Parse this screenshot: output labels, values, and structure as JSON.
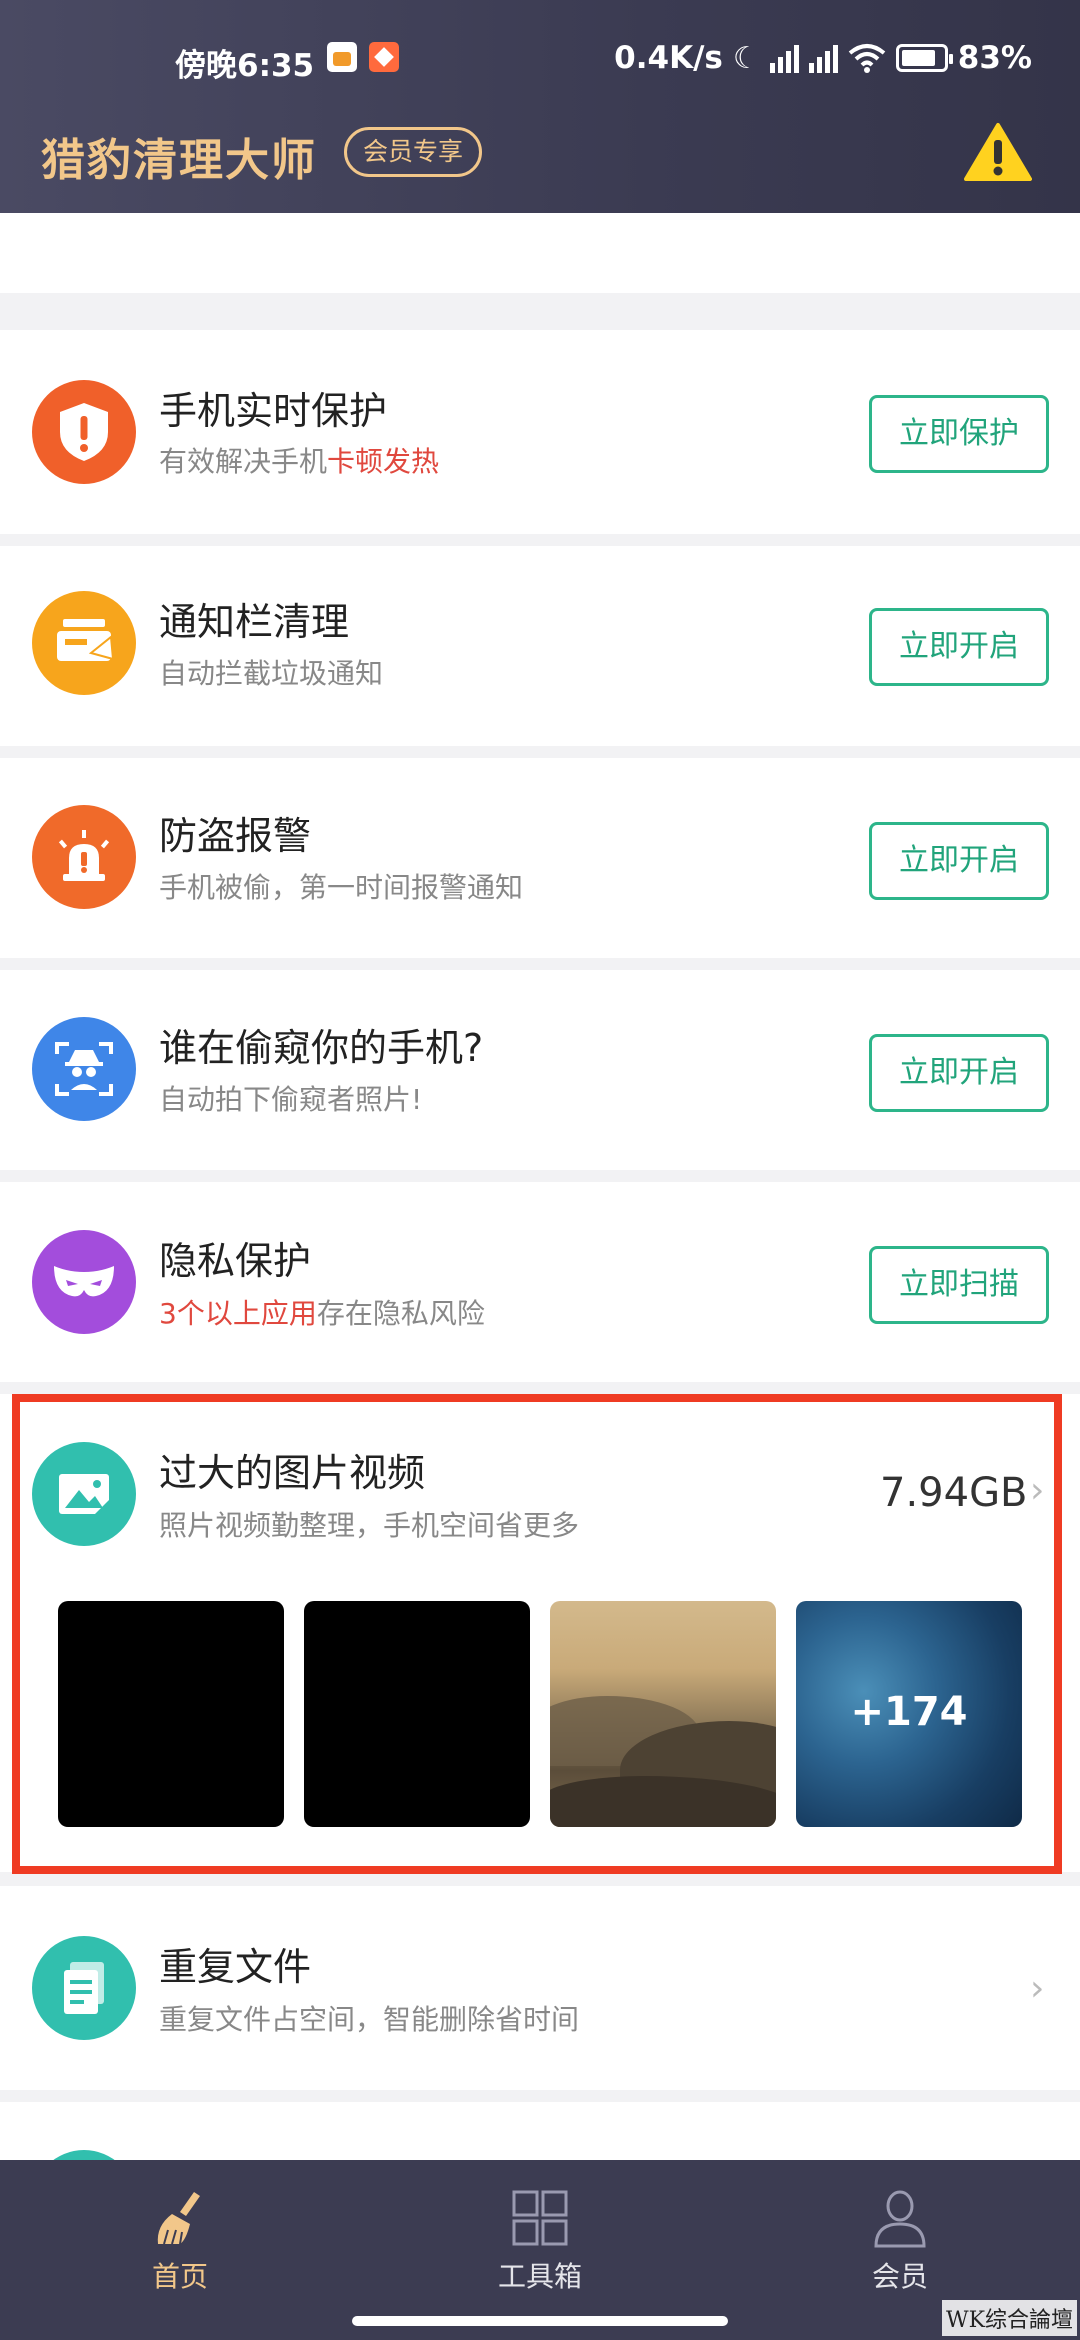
{
  "status_bar": {
    "time": "傍晚6:35",
    "network_speed": "0.4K/s",
    "battery": "83%"
  },
  "header": {
    "title": "猎豹清理大师",
    "vip_badge": "会员专享",
    "warning_icon": "warning-triangle-icon"
  },
  "cards": [
    {
      "title": "手机实时保护",
      "sub_plain": "有效解决手机",
      "sub_highlight": "卡顿发热",
      "button": "立即保护",
      "icon_color": "#f0602a",
      "icon": "shield-alert-icon"
    },
    {
      "title": "通知栏清理",
      "sub": "自动拦截垃圾通知",
      "button": "立即开启",
      "icon_color": "#f7a51c",
      "icon": "notification-clean-icon"
    },
    {
      "title": "防盗报警",
      "sub": "手机被偷，第一时间报警通知",
      "button": "立即开启",
      "icon_color": "#f06a2a",
      "icon": "alarm-siren-icon"
    },
    {
      "title": "谁在偷窥你的手机?",
      "sub": "自动拍下偷窥者照片!",
      "button": "立即开启",
      "icon_color": "#3f86e8",
      "icon": "spy-scan-icon"
    },
    {
      "title": "隐私保护",
      "sub_highlight": "3个以上应用",
      "sub_plain": "存在隐私风险",
      "button": "立即扫描",
      "icon_color": "#a34ddc",
      "icon": "mask-icon"
    }
  ],
  "large_files": {
    "title": "过大的图片视频",
    "sub": "照片视频勤整理，手机空间省更多",
    "size": "7.94GB",
    "more_count": "+174",
    "icon_color": "#31bfae",
    "icon": "image-file-icon"
  },
  "duplicate_files": {
    "title": "重复文件",
    "sub": "重复文件占空间，智能删除省时间",
    "icon_color": "#31bfae",
    "icon": "document-icon"
  },
  "bottom_nav": [
    {
      "label": "首页",
      "icon": "broom-icon",
      "active": true
    },
    {
      "label": "工具箱",
      "icon": "grid-icon",
      "active": false
    },
    {
      "label": "会员",
      "icon": "person-icon",
      "active": false
    }
  ],
  "watermark": "WK综合論壇",
  "colors": {
    "header_bg": "#3f3f57",
    "accent_gold": "#f2c78a",
    "button_green": "#2db58a",
    "highlight_red": "#ef3b23"
  }
}
